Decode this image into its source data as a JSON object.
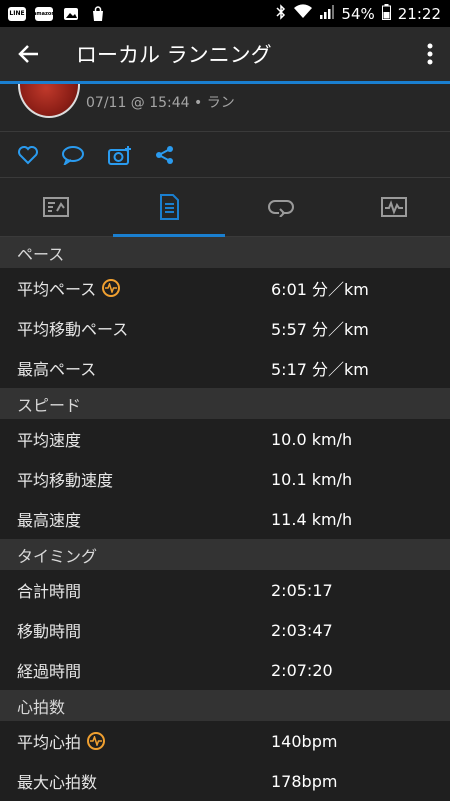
{
  "status_bar": {
    "app_icons": [
      "LINE",
      "amazon",
      "image",
      "shopping-bag"
    ],
    "battery": "54%",
    "time": "21:22"
  },
  "app_bar": {
    "title": "ローカル ランニング"
  },
  "activity": {
    "subtitle": "07/11 @ 15:44 • ラン"
  },
  "social": {
    "icons": [
      "heart-icon",
      "comment-icon",
      "camera-add-icon",
      "share-icon"
    ]
  },
  "tabs": [
    {
      "icon": "summary-icon",
      "active": false
    },
    {
      "icon": "details-icon",
      "active": true
    },
    {
      "icon": "laps-icon",
      "active": false
    },
    {
      "icon": "chart-icon",
      "active": false
    }
  ],
  "sections": {
    "pace": {
      "title": "ペース",
      "rows": [
        {
          "label": "平均ペース",
          "value": "6:01 分／km",
          "icon": "heart-rate-icon"
        },
        {
          "label": "平均移動ペース",
          "value": "5:57 分／km"
        },
        {
          "label": "最高ペース",
          "value": "5:17 分／km"
        }
      ]
    },
    "speed": {
      "title": "スピード",
      "rows": [
        {
          "label": "平均速度",
          "value": "10.0 km/h"
        },
        {
          "label": "平均移動速度",
          "value": "10.1 km/h"
        },
        {
          "label": "最高速度",
          "value": "11.4 km/h"
        }
      ]
    },
    "timing": {
      "title": "タイミング",
      "rows": [
        {
          "label": "合計時間",
          "value": "2:05:17"
        },
        {
          "label": "移動時間",
          "value": "2:03:47"
        },
        {
          "label": "経過時間",
          "value": "2:07:20"
        }
      ]
    },
    "heart": {
      "title": "心拍数",
      "rows": [
        {
          "label": "平均心拍",
          "value": "140bpm",
          "icon": "heart-rate-icon"
        },
        {
          "label": "最大心拍数",
          "value": "178bpm"
        }
      ]
    }
  },
  "colors": {
    "accent": "#1a7fd0",
    "heart_rate_icon": "#f0a030",
    "background": "#1f1f1f",
    "section_header": "#333333"
  }
}
